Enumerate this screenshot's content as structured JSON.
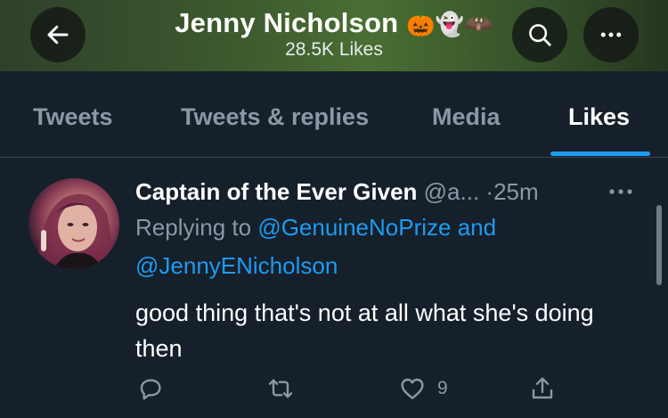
{
  "header": {
    "title": "Jenny Nicholson",
    "title_emojis": "🎃👻🦇",
    "subtitle": "28.5K Likes",
    "back_icon": "arrow-left-icon",
    "search_icon": "search-icon",
    "more_icon": "more-horizontal-icon"
  },
  "tabs": [
    {
      "label": "Tweets"
    },
    {
      "label": "Tweets & replies"
    },
    {
      "label": "Media"
    },
    {
      "label": "Likes",
      "active": true
    }
  ],
  "tweet": {
    "display_name": "Captain of the Ever Given",
    "handle": "@a...",
    "separator": "·",
    "time": "25m",
    "replying_prefix": "Replying to",
    "reply_mention_1": "@GenuineNoPrize",
    "reply_and": "and",
    "reply_mention_2": "@JennyENicholson",
    "text": "good thing that's not at all what she's doing then",
    "like_count": "9"
  },
  "colors": {
    "background": "#15202b",
    "accent": "#1d9bf0",
    "secondary_text": "#8b98a5",
    "divider": "#38444d"
  }
}
